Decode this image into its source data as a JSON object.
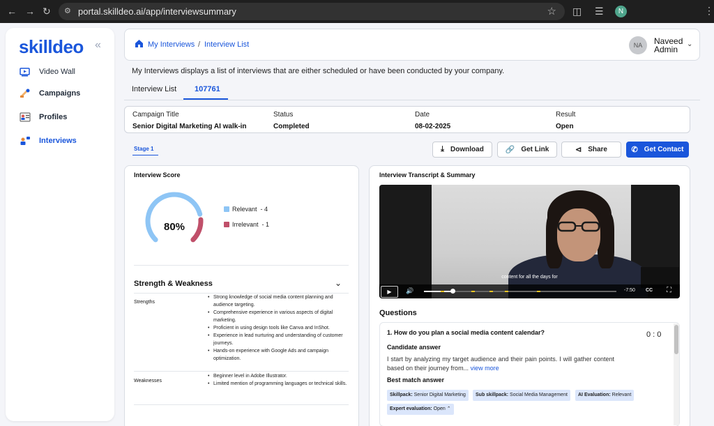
{
  "browser": {
    "url": "portal.skilldeo.ai/app/interviewsummary",
    "profile_initial": "N"
  },
  "sidebar": {
    "logo": "skilldeo",
    "items": [
      {
        "label": "Video Wall",
        "icon": "video-icon"
      },
      {
        "label": "Campaigns",
        "icon": "campaign-icon"
      },
      {
        "label": "Profiles",
        "icon": "profile-icon"
      },
      {
        "label": "Interviews",
        "icon": "interview-icon",
        "active": true
      }
    ]
  },
  "header": {
    "breadcrumb": [
      "My Interviews",
      "Interview List"
    ],
    "separator": "/",
    "user": {
      "initials": "NA",
      "name": "Naveed",
      "role": "Admin"
    }
  },
  "description": "My Interviews displays a list of interviews that are either scheduled or have been conducted by your company.",
  "tabs": [
    {
      "label": "Interview List",
      "active": false
    },
    {
      "label": "107761",
      "active": true
    }
  ],
  "summary": {
    "campaign_title_label": "Campaign Title",
    "campaign_title": "Senior Digital Marketing AI walk-in",
    "status_label": "Status",
    "status": "Completed",
    "date_label": "Date",
    "date": "08-02-2025",
    "result_label": "Result",
    "result": "Open"
  },
  "stage": "Stage 1",
  "actions": {
    "download": "Download",
    "get_link": "Get Link",
    "share": "Share",
    "get_contact": "Get Contact"
  },
  "score": {
    "title": "Interview Score",
    "percent_label": "80%",
    "relevant_fraction": 0.8,
    "relevant_label": "Relevant",
    "relevant_count": "- 4",
    "irrelevant_label": "Irrelevant",
    "irrelevant_count": "- 1",
    "colors": {
      "relevant": "#8ec5f5",
      "irrelevant": "#c0506a"
    }
  },
  "strength_weakness": {
    "title": "Strength & Weakness",
    "strengths_label": "Strengths",
    "strengths": [
      "Strong knowledge of social media content planning and audience targeting.",
      "Comprehensive experience in various aspects of digital marketing.",
      "Proficient in using design tools like Canva and InShot.",
      "Experience in lead nurturing and understanding of customer journeys.",
      "Hands-on experience with Google Ads and campaign optimization."
    ],
    "weaknesses_label": "Weaknesses",
    "weaknesses": [
      "Beginner level in Adobe Illustrator.",
      "Limited mention of programming languages or technical skills."
    ]
  },
  "transcript": {
    "title": "Interview Transcript & Summary",
    "video": {
      "caption": "content for all the days for",
      "time_remaining": "-7:50",
      "cc": "CC",
      "progress_fraction": 0.15
    },
    "questions_title": "Questions",
    "question": {
      "text": "1. How do you plan a social media content calendar?",
      "score": "0 : 0",
      "candidate_label": "Candidate answer",
      "candidate_answer": "I start by analyzing my target audience and their pain points. I will gather content based on their journey from...",
      "view_more": "view more",
      "best_label": "Best match answer",
      "chips": {
        "skillpack_label": "Skillpack:",
        "skillpack": "Senior Digital Marketing",
        "subskill_label": "Sub skillpack:",
        "subskill": "Social Media Management",
        "ai_label": "AI Evaluation:",
        "ai": "Relevant",
        "expert_label": "Expert evaluation:",
        "expert": "Open"
      }
    }
  },
  "colors": {
    "accent": "#1a56db"
  }
}
